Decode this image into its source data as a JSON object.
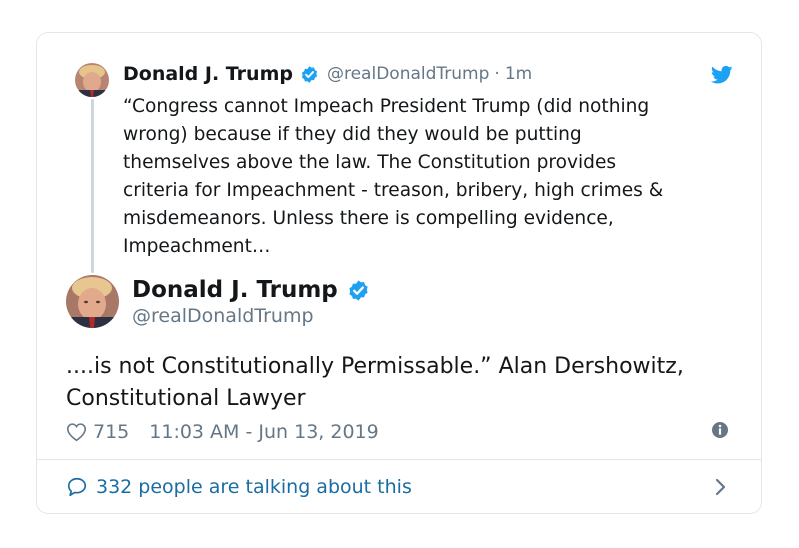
{
  "parent_tweet": {
    "name": "Donald J. Trump",
    "handle": "@realDonaldTrump",
    "separator": "·",
    "time": "1m",
    "text": "“Congress cannot Impeach President Trump (did nothing\nwrong) because if they did they would be putting\nthemselves above the law. The Constitution provides\ncriteria for Impeachment - treason, bribery, high crimes &\nmisdemeanors. Unless there is compelling evidence,\nImpeachment…"
  },
  "main_tweet": {
    "name": "Donald J. Trump",
    "handle": "@realDonaldTrump",
    "text": "....is not Constitutionally Permissable.” Alan Dershowitz,\nConstitutional Lawyer",
    "likes": "715",
    "timestamp": "11:03 AM - Jun 13, 2019"
  },
  "footer": {
    "talking": "332 people are talking about this"
  },
  "colors": {
    "twitter_blue": "#1da1f2",
    "link_blue": "#1b6ca3",
    "muted": "#657786",
    "border": "#e1e8ed"
  },
  "icons": [
    "verified-badge-icon",
    "twitter-bird-icon",
    "heart-icon",
    "info-icon",
    "speech-bubble-icon",
    "chevron-right-icon"
  ]
}
